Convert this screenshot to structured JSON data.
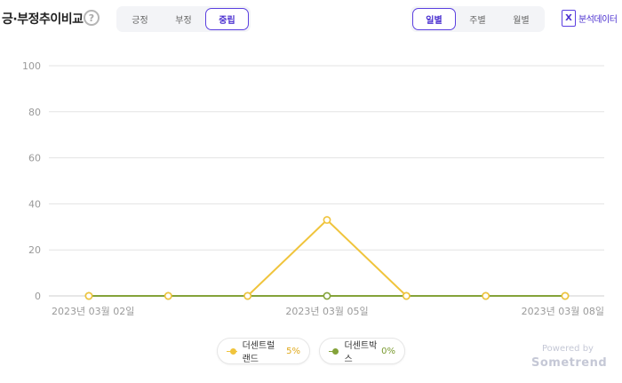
{
  "header": {
    "title": "긍·부정추이비교",
    "help_glyph": "?",
    "sentiment_tabs": [
      "긍정",
      "부정",
      "중립"
    ],
    "period_tabs": [
      "일별",
      "주별",
      "월별"
    ],
    "export_label": "분석데이터",
    "export_glyph": "X"
  },
  "colors": {
    "series_1": "#f0c43c",
    "series_2": "#84a33a",
    "accent": "#5b3fe0",
    "grid": "#e3e3e3",
    "tick_text": "#9a9a9a"
  },
  "chart_data": {
    "type": "line",
    "x": [
      "2023-03-02",
      "2023-03-03",
      "2023-03-04",
      "2023-03-05",
      "2023-03-06",
      "2023-03-07",
      "2023-03-08"
    ],
    "x_tick_labels": [
      "2023년 03월 02일",
      "2023년 03월 05일",
      "2023년 03월 08일"
    ],
    "x_tick_index": [
      0,
      3,
      6
    ],
    "ylim": [
      0,
      100
    ],
    "y_ticks": [
      0,
      20,
      40,
      60,
      80,
      100
    ],
    "grid": true,
    "legend_position": "bottom-center",
    "series": [
      {
        "name": "더센트럴랜드",
        "share": "5%",
        "values": [
          0,
          0,
          0,
          33,
          0,
          0,
          0
        ]
      },
      {
        "name": "더센트박스",
        "share": "0%",
        "values": [
          0,
          0,
          0,
          0,
          0,
          0,
          0
        ]
      }
    ]
  },
  "footer": {
    "powered_by": "Powered by",
    "brand": "Sometrend"
  }
}
